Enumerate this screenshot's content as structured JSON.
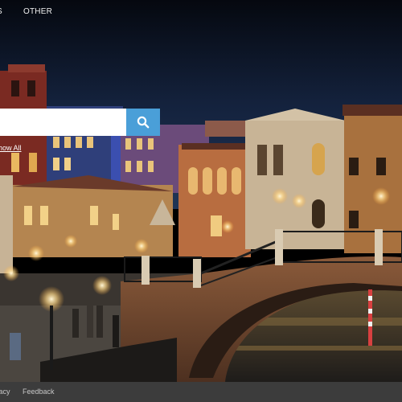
{
  "nav": {
    "items": [
      "S",
      "OTHER"
    ]
  },
  "search": {
    "value": "",
    "placeholder": "",
    "button_icon": "search-icon",
    "accent_color": "#4a9fd8"
  },
  "show_all_label": "how All",
  "footer": {
    "privacy_label": "vacy",
    "feedback_label": "Feedback"
  },
  "background": {
    "subject": "night-venice-canal-scene"
  }
}
